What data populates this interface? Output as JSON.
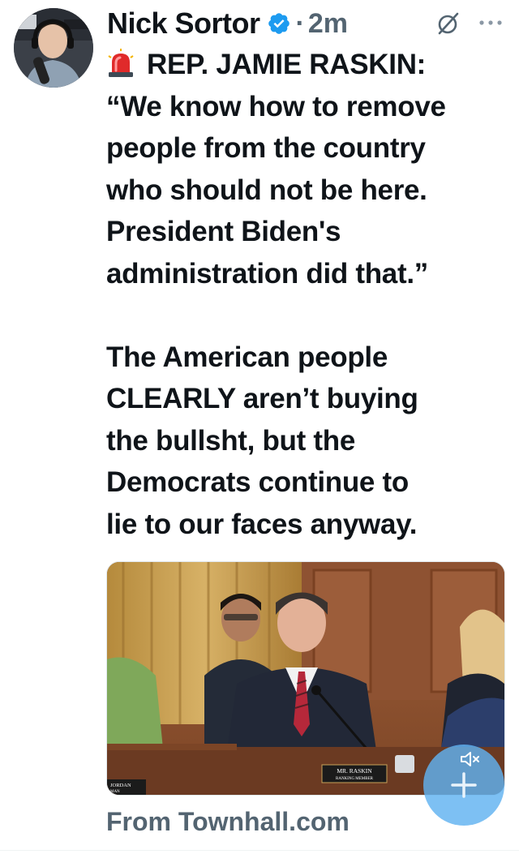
{
  "author": {
    "name": "Nick Sortor",
    "verified": true,
    "separator": "·",
    "time": "2m"
  },
  "post": {
    "lines_p1": [
      "REP. JAMIE RASKIN:",
      "“We know how to remove",
      "people from the country",
      "who should not be here.",
      "President Biden's",
      "administration did that.”"
    ],
    "lines_p2": [
      "The American people",
      "CLEARLY aren’t buying",
      "the bullsht, but the",
      "Democrats continue to",
      "lie to our faces anyway."
    ]
  },
  "media": {
    "nameplate_line1": "MR. RASKIN",
    "nameplate_line2": "RANKING MEMBER",
    "left_nameplate": "JORDAN",
    "left_nameplate_sub": "MAN"
  },
  "card": {
    "source": "From Townhall.com"
  },
  "icons": {
    "verified": "verified-badge-icon",
    "grok": "grok-icon",
    "more": "more-icon",
    "siren": "siren-emoji-icon",
    "mute": "speaker-muted-icon",
    "compose": "plus-icon"
  },
  "colors": {
    "verified_blue": "#1d9bf0",
    "secondary_text": "#536471",
    "fab": "#60b2f0"
  }
}
